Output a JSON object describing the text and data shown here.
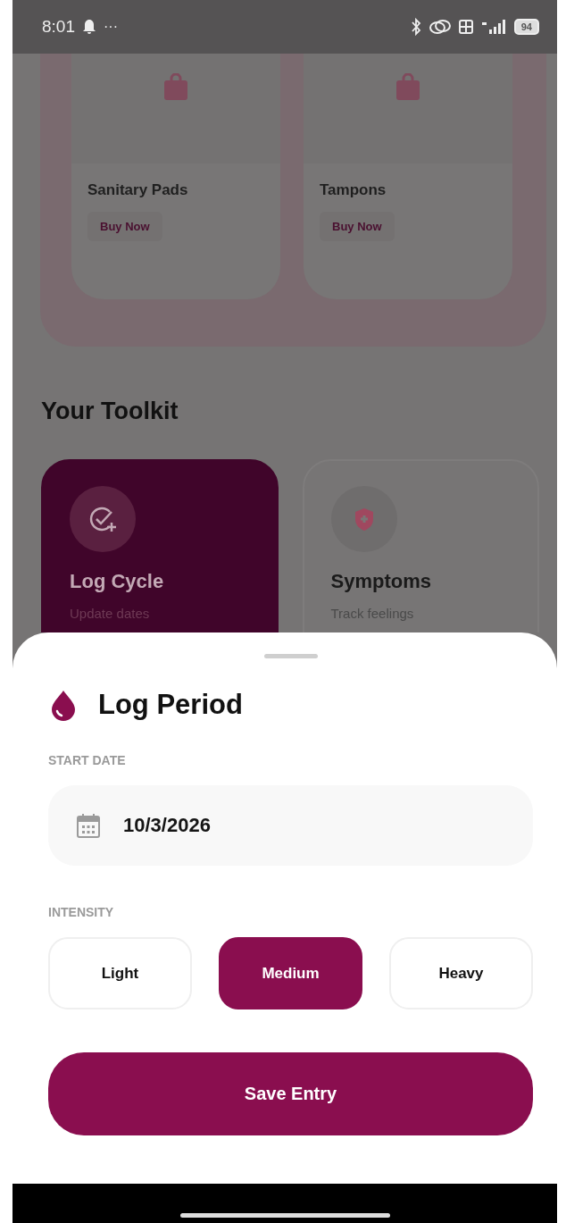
{
  "status_bar": {
    "time": "8:01",
    "more": "···",
    "battery": "94"
  },
  "products": [
    {
      "name": "Sanitary Pads",
      "action": "Buy Now"
    },
    {
      "name": "Tampons",
      "action": "Buy Now"
    }
  ],
  "toolkit": {
    "title": "Your Toolkit",
    "cards": [
      {
        "kind": "cycle",
        "title": "Log Cycle",
        "subtitle": "Update dates",
        "selected": true
      },
      {
        "kind": "symptoms",
        "title": "Symptoms",
        "subtitle": "Track feelings",
        "selected": false
      }
    ]
  },
  "sheet": {
    "title": "Log Period",
    "start_date": {
      "label": "START DATE",
      "value": "10/3/2026"
    },
    "intensity": {
      "label": "INTENSITY",
      "options": [
        {
          "label": "Light",
          "selected": false
        },
        {
          "label": "Medium",
          "selected": true
        },
        {
          "label": "Heavy",
          "selected": false
        }
      ]
    },
    "save_button": "Save Entry"
  }
}
